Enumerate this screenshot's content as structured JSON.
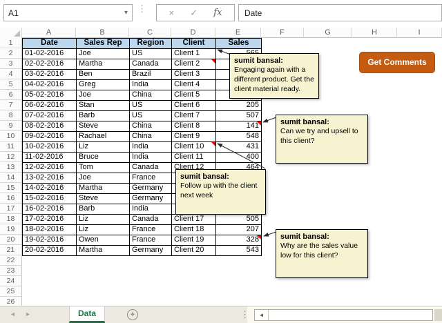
{
  "name_box": {
    "value": "A1"
  },
  "formula_bar": {
    "value": "Date"
  },
  "icons": {
    "namebox_dropdown": "▾",
    "formula_cancel": "×",
    "formula_enter": "✓",
    "formula_fx": "fx",
    "vertical_dots": "⋮",
    "tab_prev": "◄",
    "tab_next": "►",
    "add_sheet": "+",
    "scroll_left": "◄"
  },
  "grid": {
    "column_letters": [
      "A",
      "B",
      "C",
      "D",
      "E",
      "F",
      "G",
      "H",
      "I"
    ],
    "row_numbers": [
      1,
      2,
      3,
      4,
      5,
      6,
      7,
      8,
      9,
      10,
      11,
      12,
      13,
      14,
      15,
      16,
      17,
      18,
      19,
      20,
      21,
      22,
      23,
      24,
      25,
      26
    ]
  },
  "table": {
    "headers": [
      "Date",
      "Sales Rep",
      "Region",
      "Client",
      "Sales"
    ],
    "rows": [
      [
        "01-02-2016",
        "Joe",
        "US",
        "Client 1",
        "565"
      ],
      [
        "02-02-2016",
        "Martha",
        "Canada",
        "Client 2",
        ""
      ],
      [
        "03-02-2016",
        "Ben",
        "Brazil",
        "Client 3",
        ""
      ],
      [
        "04-02-2016",
        "Greg",
        "India",
        "Client 4",
        ""
      ],
      [
        "05-02-2016",
        "Joe",
        "China",
        "Client 5",
        ""
      ],
      [
        "06-02-2016",
        "Stan",
        "US",
        "Client 6",
        "205"
      ],
      [
        "07-02-2016",
        "Barb",
        "US",
        "Client 7",
        "507"
      ],
      [
        "08-02-2016",
        "Steve",
        "China",
        "Client 8",
        "141"
      ],
      [
        "09-02-2016",
        "Rachael",
        "China",
        "Client 9",
        "548"
      ],
      [
        "10-02-2016",
        "Liz",
        "India",
        "Client 10",
        "431"
      ],
      [
        "11-02-2016",
        "Bruce",
        "India",
        "Client 11",
        "400"
      ],
      [
        "12-02-2016",
        "Tom",
        "Canada",
        "Client 12",
        "464"
      ],
      [
        "13-02-2016",
        "Joe",
        "France",
        "",
        ""
      ],
      [
        "14-02-2016",
        "Martha",
        "Germany",
        "",
        ""
      ],
      [
        "15-02-2016",
        "Steve",
        "Germany",
        "",
        ""
      ],
      [
        "16-02-2016",
        "Barb",
        "India",
        "",
        ""
      ],
      [
        "17-02-2016",
        "Liz",
        "Canada",
        "Client 17",
        "505"
      ],
      [
        "18-02-2016",
        "Liz",
        "France",
        "Client 18",
        "207"
      ],
      [
        "19-02-2016",
        "Owen",
        "France",
        "Client 19",
        "328"
      ],
      [
        "20-02-2016",
        "Martha",
        "Germany",
        "Client 20",
        "543"
      ]
    ]
  },
  "comments": [
    {
      "author": "sumit bansal:",
      "text": "Engaging again with a different product. Get the client material ready."
    },
    {
      "author": "sumit bansal:",
      "text": "Can we try and upsell to this client?"
    },
    {
      "author": "sumit bansal:",
      "text": "Follow up with the client next week"
    },
    {
      "author": "sumit bansal:",
      "text": "Why are the sales value low for this client?"
    }
  ],
  "button": {
    "label": "Get Comments"
  },
  "sheet_tabs": {
    "active": "Data"
  },
  "colors": {
    "table_header_fill": "#BDD7EE",
    "button_bg": "#C55A11",
    "comment_bg": "#F7F3D0",
    "tab_green": "#1E7145",
    "indicator_red": "#FF0000"
  }
}
